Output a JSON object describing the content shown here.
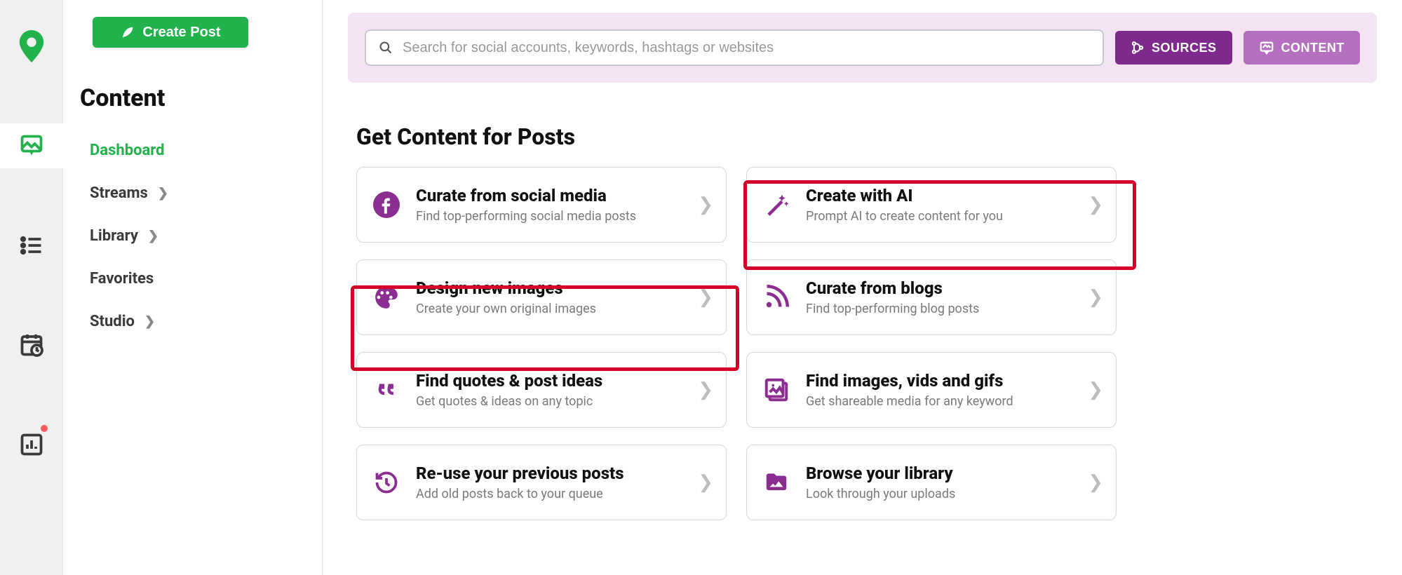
{
  "sidebar": {
    "create_label": "Create Post",
    "section_title": "Content",
    "nav": [
      {
        "label": "Dashboard",
        "has_chevron": false,
        "active": true
      },
      {
        "label": "Streams",
        "has_chevron": true,
        "active": false
      },
      {
        "label": "Library",
        "has_chevron": true,
        "active": false
      },
      {
        "label": "Favorites",
        "has_chevron": false,
        "active": false
      },
      {
        "label": "Studio",
        "has_chevron": true,
        "active": false
      }
    ]
  },
  "search": {
    "placeholder": "Search for social accounts, keywords, hashtags or websites",
    "sources_label": "SOURCES",
    "content_label": "CONTENT"
  },
  "main": {
    "heading": "Get Content for Posts",
    "cards": [
      {
        "icon": "facebook",
        "title": "Curate from social media",
        "sub": "Find top-performing social media posts",
        "highlight": false
      },
      {
        "icon": "wand",
        "title": "Create with AI",
        "sub": "Prompt AI to create content for you",
        "highlight": true
      },
      {
        "icon": "palette",
        "title": "Design new images",
        "sub": "Create your own original images",
        "highlight": true
      },
      {
        "icon": "rss",
        "title": "Curate from blogs",
        "sub": "Find top-performing blog posts",
        "highlight": false
      },
      {
        "icon": "quotes",
        "title": "Find quotes & post ideas",
        "sub": "Get quotes & ideas on any topic",
        "highlight": false
      },
      {
        "icon": "gallery",
        "title": "Find images, vids and gifs",
        "sub": "Get shareable media for any keyword",
        "highlight": false
      },
      {
        "icon": "history",
        "title": "Re-use your previous posts",
        "sub": "Add old posts back to your queue",
        "highlight": false
      },
      {
        "icon": "folder",
        "title": "Browse your library",
        "sub": "Look through your uploads",
        "highlight": false
      }
    ]
  },
  "colors": {
    "brand_green": "#22b24c",
    "brand_purple": "#8c2d91",
    "highlight_red": "#d4002a"
  }
}
